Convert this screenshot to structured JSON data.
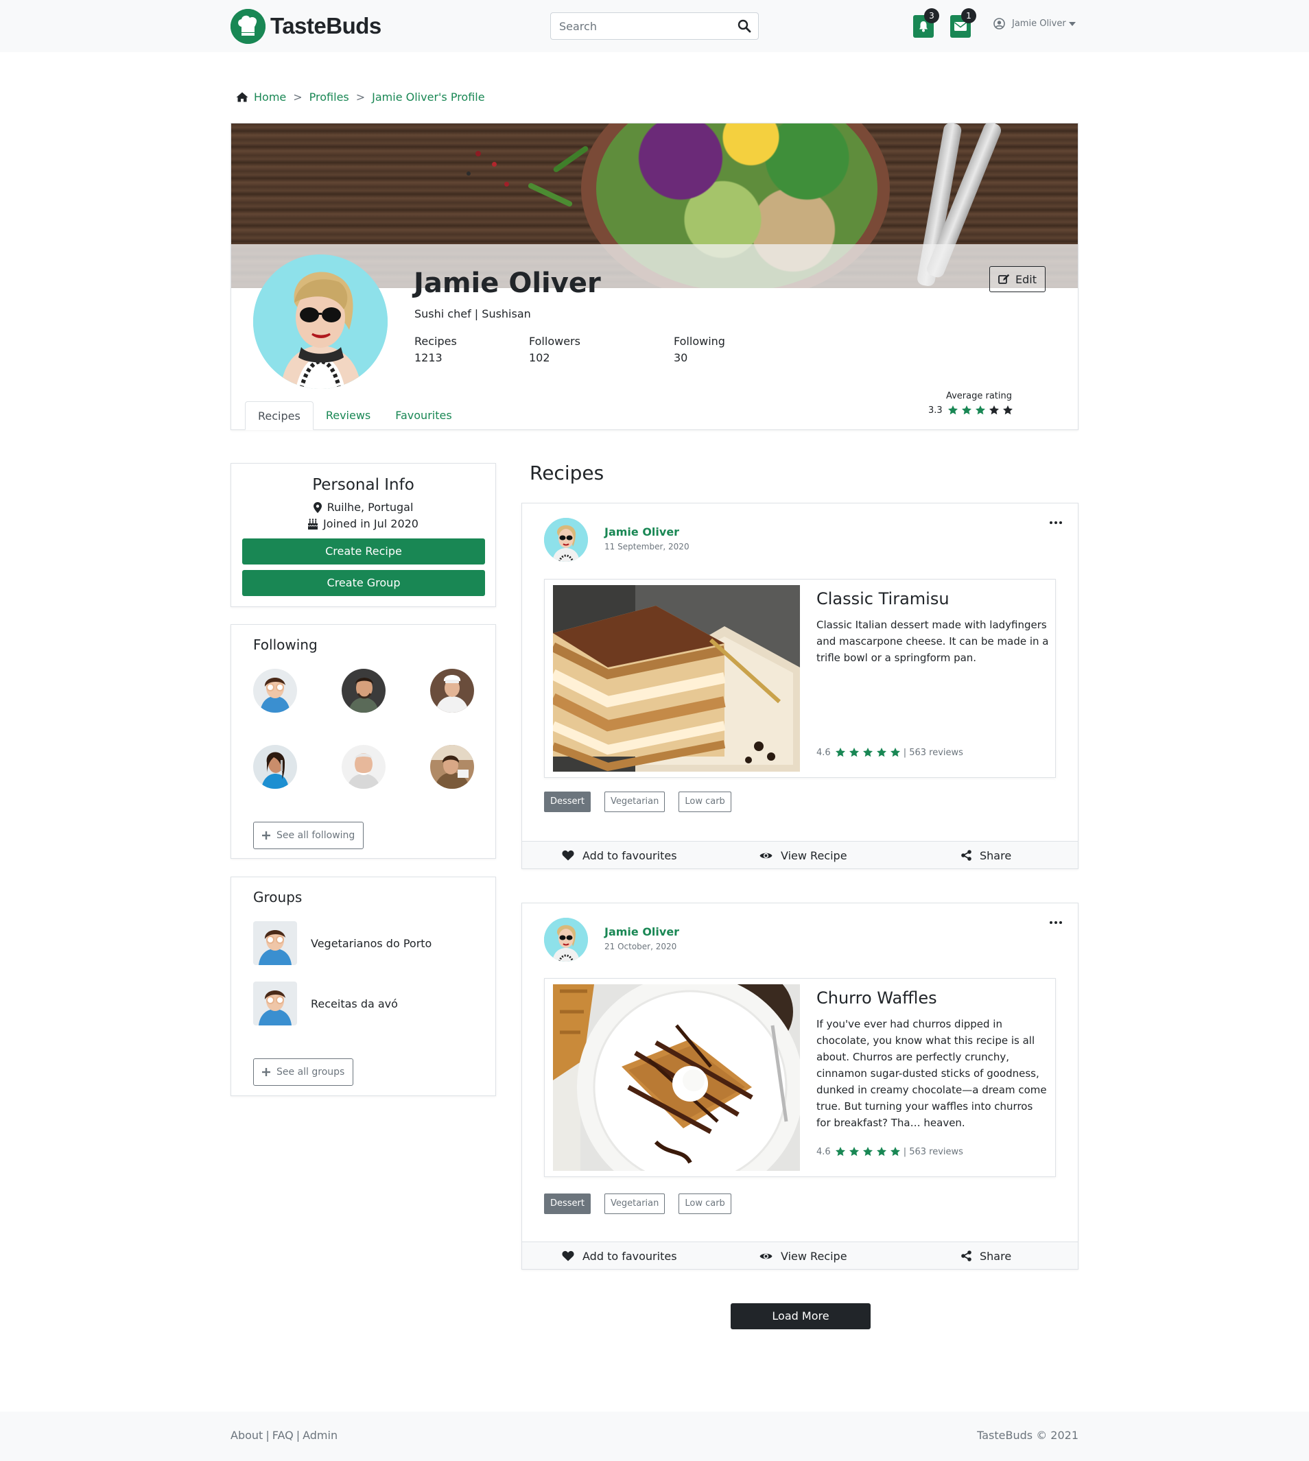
{
  "app": {
    "name": "TasteBuds"
  },
  "navbar": {
    "search_placeholder": "Search",
    "notifications_count": "3",
    "messages_count": "1",
    "user_name": "Jamie Oliver"
  },
  "breadcrumb": {
    "items": [
      "Home",
      "Profiles",
      "Jamie Oliver's Profile"
    ]
  },
  "profile": {
    "name": "Jamie Oliver",
    "role": "Sushi chef | Sushisan",
    "edit_label": "Edit",
    "stats": [
      {
        "label": "Recipes",
        "value": "1213"
      },
      {
        "label": "Followers",
        "value": "102"
      },
      {
        "label": "Following",
        "value": "30"
      }
    ],
    "average_rating_label": "Average rating",
    "average_rating": "3.3",
    "average_rating_stars": 3,
    "tabs": [
      "Recipes",
      "Reviews",
      "Favourites"
    ],
    "active_tab": "Recipes"
  },
  "personal_info": {
    "title": "Personal Info",
    "location": "Ruilhe, Portugal",
    "joined": "Joined in Jul 2020",
    "create_recipe_label": "Create Recipe",
    "create_group_label": "Create Group"
  },
  "following": {
    "title": "Following",
    "see_all_label": "See all following"
  },
  "groups": {
    "title": "Groups",
    "items": [
      "Vegetarianos do Porto",
      "Receitas da avó"
    ],
    "see_all_label": "See all groups"
  },
  "recipes_section": {
    "title": "Recipes",
    "posts": [
      {
        "author": "Jamie Oliver",
        "date": "11 September, 2020",
        "recipe_title": "Classic Tiramisu",
        "description": "Classic Italian dessert made with ladyfingers and mascarpone cheese. It can be made in a trifle bowl or a springform pan.",
        "rating": "4.6",
        "stars": 5,
        "reviews": "| 563 reviews",
        "tags": [
          "Dessert",
          "Vegetarian",
          "Low carb"
        ],
        "actions": {
          "favourite": "Add to favourites",
          "view": "View Recipe",
          "share": "Share"
        }
      },
      {
        "author": "Jamie Oliver",
        "date": "21 October, 2020",
        "recipe_title": "Churro Waffles",
        "description": "If you've ever had churros dipped in chocolate, you know what this recipe is all about. Churros are perfectly crunchy, cinnamon sugar-dusted sticks of goodness, dunked in creamy chocolate—a dream come true. But turning your waffles into churros for breakfast? Tha… heaven.",
        "rating": "4.6",
        "stars": 5,
        "reviews": "| 563 reviews",
        "tags": [
          "Dessert",
          "Vegetarian",
          "Low carb"
        ],
        "actions": {
          "favourite": "Add to favourites",
          "view": "View Recipe",
          "share": "Share"
        }
      }
    ],
    "load_more_label": "Load More"
  },
  "footer": {
    "links": [
      "About",
      "FAQ",
      "Admin"
    ],
    "copyright": "TasteBuds © 2021"
  },
  "colors": {
    "brand_green": "#198754",
    "dark": "#212529",
    "muted": "#6c757d",
    "background_light": "#f8f9fa"
  },
  "icons": {
    "logo": "chef-hat-logo-icon",
    "search": "search-icon",
    "notifications": "bell-icon",
    "messages": "envelope-icon",
    "user": "user-circle-icon",
    "home": "home-icon",
    "edit": "edit-icon",
    "star": "star-icon",
    "location": "map-marker-icon",
    "joined": "birthday-cake-icon",
    "add": "plus-icon",
    "more": "ellipsis-icon",
    "favourite": "heart-icon",
    "view": "eye-icon",
    "share": "share-icon"
  }
}
